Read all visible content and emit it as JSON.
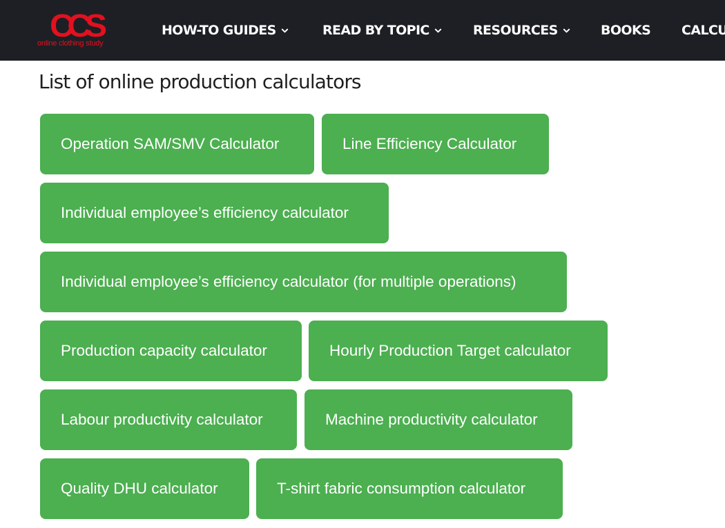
{
  "brand": {
    "logo_mark": "CCS",
    "tagline": "online clothing study",
    "color": "#e3101f"
  },
  "nav": {
    "background": "#1e1f24",
    "items": [
      {
        "label": "HOW-TO GUIDES",
        "icon": "chevron-down-icon"
      },
      {
        "label": "READ BY TOPIC",
        "icon": "chevron-down-icon"
      },
      {
        "label": "RESOURCES",
        "icon": "chevron-down-icon"
      },
      {
        "label": "BOOKS",
        "icon": ""
      },
      {
        "label": "CALCU",
        "icon": ""
      }
    ]
  },
  "page": {
    "title": "List of online production calculators"
  },
  "calculators": {
    "button_color": "#4caf50",
    "items": [
      {
        "label": "Operation SAM/SMV Calculator"
      },
      {
        "label": "Line Efficiency Calculator"
      },
      {
        "label": "Individual employee’s efficiency calculator"
      },
      {
        "label": "Individual employee’s efficiency calculator (for multiple operations)"
      },
      {
        "label": "Production capacity calculator"
      },
      {
        "label": "Hourly Production Target calculator"
      },
      {
        "label": "Labour productivity calculator"
      },
      {
        "label": "Machine productivity calculator"
      },
      {
        "label": "Quality DHU calculator"
      },
      {
        "label": "T-shirt fabric consumption calculator"
      }
    ]
  }
}
